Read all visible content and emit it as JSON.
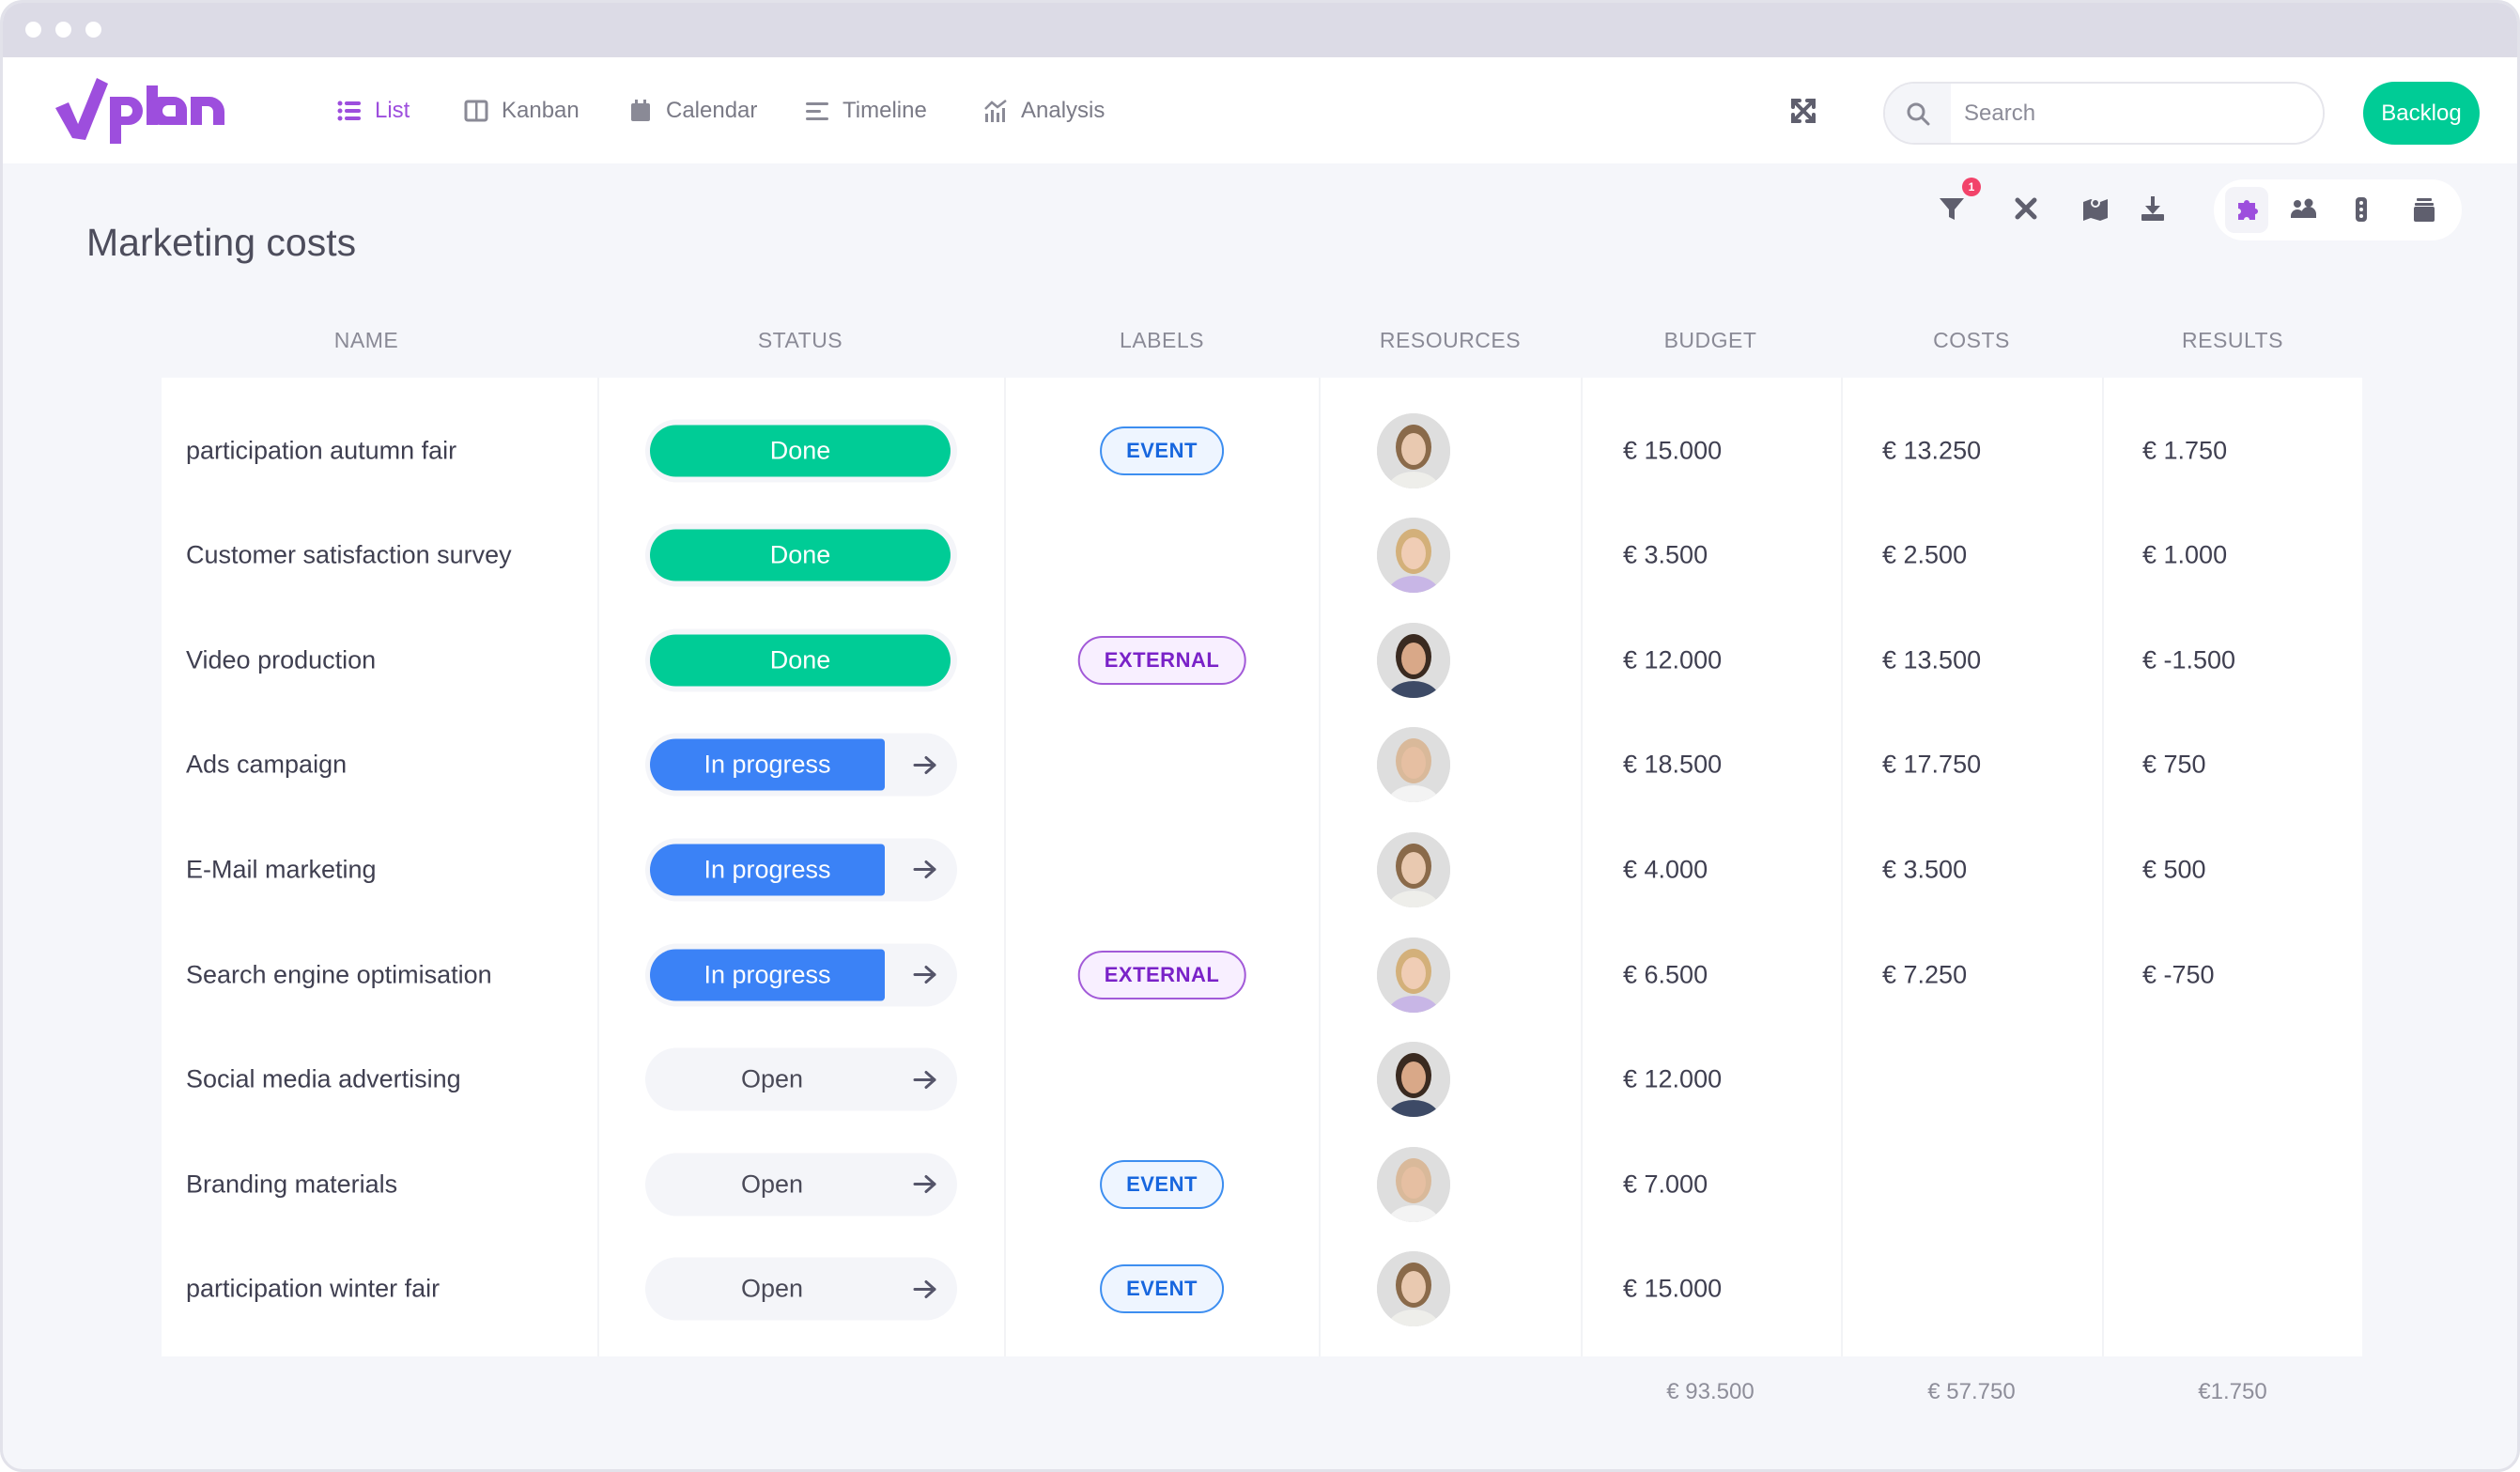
{
  "app": {
    "brand": "vplan",
    "brand_color": "#9d4edd",
    "accent_green": "#00cc96",
    "accent_blue": "#3b82f6"
  },
  "nav": {
    "items": [
      {
        "label": "List",
        "icon": "list-icon",
        "active": true
      },
      {
        "label": "Kanban",
        "icon": "kanban-icon",
        "active": false
      },
      {
        "label": "Calendar",
        "icon": "calendar-icon",
        "active": false
      },
      {
        "label": "Timeline",
        "icon": "timeline-icon",
        "active": false
      },
      {
        "label": "Analysis",
        "icon": "analysis-icon",
        "active": false
      }
    ]
  },
  "header": {
    "search_placeholder": "Search",
    "search_value": "",
    "backlog_label": "Backlog"
  },
  "toolbar": {
    "filter_badge": "1",
    "icons": [
      "filter-icon",
      "tools-icon",
      "map-icon",
      "download-icon"
    ],
    "group_icons": [
      "puzzle-icon",
      "users-settings-icon",
      "traffic-light-icon",
      "archive-icon"
    ]
  },
  "page": {
    "title": "Marketing costs"
  },
  "table": {
    "columns": [
      "NAME",
      "STATUS",
      "LABELS",
      "RESOURCES",
      "BUDGET",
      "COSTS",
      "RESULTS"
    ],
    "rows": [
      {
        "name": "participation autumn fair",
        "status": "Done",
        "status_type": "done",
        "label": "EVENT",
        "label_type": "event",
        "avatar": "woman-brown-hair",
        "budget": "€ 15.000",
        "costs": "€ 13.250",
        "results": "€ 1.750"
      },
      {
        "name": "Customer satisfaction survey",
        "status": "Done",
        "status_type": "done",
        "label": "",
        "label_type": "",
        "avatar": "woman-blonde-hair",
        "budget": "€ 3.500",
        "costs": "€ 2.500",
        "results": "€ 1.000"
      },
      {
        "name": "Video production",
        "status": "Done",
        "status_type": "done",
        "label": "EXTERNAL",
        "label_type": "external",
        "avatar": "man-beard",
        "budget": "€ 12.000",
        "costs": "€ 13.500",
        "results": "€ -1.500"
      },
      {
        "name": "Ads campaign",
        "status": "In progress",
        "status_type": "prog",
        "label": "",
        "label_type": "",
        "avatar": "man-bald",
        "budget": "€ 18.500",
        "costs": "€ 17.750",
        "results": "€ 750"
      },
      {
        "name": "E-Mail marketing",
        "status": "In progress",
        "status_type": "prog",
        "label": "",
        "label_type": "",
        "avatar": "woman-brown-hair",
        "budget": "€ 4.000",
        "costs": "€ 3.500",
        "results": "€ 500"
      },
      {
        "name": "Search engine optimisation",
        "status": "In progress",
        "status_type": "prog",
        "label": "EXTERNAL",
        "label_type": "external",
        "avatar": "woman-blonde-hair",
        "budget": "€ 6.500",
        "costs": "€ 7.250",
        "results": "€ -750"
      },
      {
        "name": "Social media advertising",
        "status": "Open",
        "status_type": "open",
        "label": "",
        "label_type": "",
        "avatar": "man-beard",
        "budget": "€ 12.000",
        "costs": "",
        "results": ""
      },
      {
        "name": "Branding materials",
        "status": "Open",
        "status_type": "open",
        "label": "EVENT",
        "label_type": "event",
        "avatar": "man-bald",
        "budget": "€ 7.000",
        "costs": "",
        "results": ""
      },
      {
        "name": "participation winter fair",
        "status": "Open",
        "status_type": "open",
        "label": "EVENT",
        "label_type": "event",
        "avatar": "woman-brown-hair",
        "budget": "€ 15.000",
        "costs": "",
        "results": ""
      }
    ],
    "totals": {
      "budget": "€ 93.500",
      "costs": "€ 57.750",
      "results": "€1.750"
    }
  }
}
